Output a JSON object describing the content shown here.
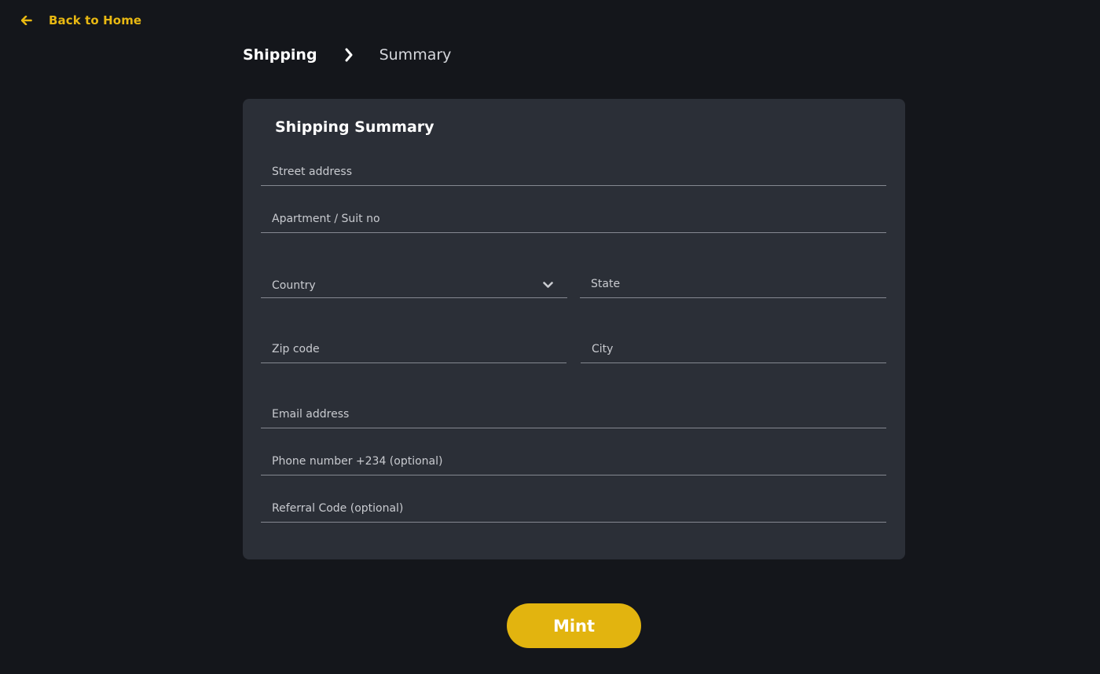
{
  "nav": {
    "back_label": "Back to Home",
    "back_icon": "arrow-left-icon"
  },
  "steps": {
    "active": "Shipping",
    "separator_icon": "chevron-right-icon",
    "inactive": "Summary"
  },
  "form": {
    "title": "Shipping Summary",
    "street": {
      "placeholder": "Street address",
      "value": ""
    },
    "apartment": {
      "placeholder": "Apartment / Suit no",
      "value": ""
    },
    "country": {
      "label": "Country",
      "icon": "chevron-down-icon"
    },
    "state": {
      "placeholder": "State",
      "value": ""
    },
    "zip": {
      "placeholder": "Zip code",
      "value": ""
    },
    "city": {
      "placeholder": "City",
      "value": ""
    },
    "email": {
      "placeholder": "Email address",
      "value": ""
    },
    "phone": {
      "placeholder": "Phone number +234 (optional)",
      "value": ""
    },
    "referral": {
      "placeholder": "Referral Code (optional)",
      "value": ""
    }
  },
  "actions": {
    "mint_label": "Mint"
  },
  "colors": {
    "background": "#14161b",
    "card": "#2b2f37",
    "accent": "#e2b40f",
    "field_line": "#858891"
  }
}
